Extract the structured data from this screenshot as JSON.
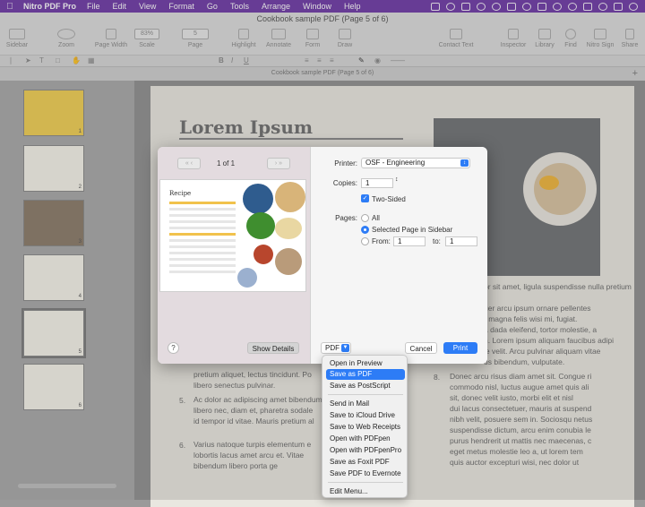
{
  "menubar": {
    "app": "Nitro PDF Pro",
    "items": [
      "File",
      "Edit",
      "View",
      "Format",
      "Go",
      "Tools",
      "Arrange",
      "Window",
      "Help"
    ],
    "clock_date": "",
    "bg_color": "#6e3aa6"
  },
  "toolbar": {
    "document_title": "Cookbook sample PDF (Page 5 of 6)",
    "items": [
      "Sidebar",
      "Zoom",
      "Page Width",
      "Scale",
      "Page",
      "Highlight",
      "Annotate",
      "Form",
      "Draw",
      "Contact Text",
      "Inspector",
      "Library",
      "Find",
      "Nitro Sign",
      "Share"
    ],
    "scale_value": "83%",
    "page_value": "5"
  },
  "tabbar": {
    "tab_title": "Cookbook sample PDF (Page 5 of 6)"
  },
  "sidebar": {
    "thumb_labels": [
      "1",
      "2",
      "3",
      "4",
      "5",
      "6"
    ]
  },
  "page": {
    "title": "Lorem Ipsum",
    "right_lines": [
      "or sit amet, ligula suspendisse nulla pretium",
      "uer arcu ipsum ornare pellentes",
      "r magna felis wisi mi, fugiat.",
      "a dada eleifend, tortor molestie, a",
      "n. Lorem ipsum aliquam faucibus adipi",
      "ie velit. Arcu pulvinar aliquam vitae",
      "us bibendum, vulputate."
    ],
    "left_items": [
      {
        "num": "",
        "lines": [
          "pretium aliquet, lectus tincidunt. Po",
          "libero senectus pulvinar."
        ]
      },
      {
        "num": "5.",
        "lines": [
          "Ac dolor ac adipiscing amet bibendum",
          "libero nec, diam et, pharetra sodale",
          "id tempor id vitae. Mauris pretium al"
        ]
      },
      {
        "num": "6.",
        "lines": [
          "Varius natoque turpis elementum e",
          "lobortis lacus amet arcu et. Vitae",
          "bibendum libero porta ge"
        ]
      }
    ],
    "right_items": [
      {
        "num": "8.",
        "lines": [
          "Donec arcu risus diam amet sit. Congue ri",
          "commodo nisl, luctus augue amet quis ali",
          "sit, donec velit iusto, morbi elit et nisl",
          "dui lacus consectetuer, mauris at suspend",
          "nibh velit, posuere sem in. Sociosqu netus",
          "suspendisse dictum, arcu enim conubia le",
          "purus hendrerit ut mattis nec maecenas, c",
          "eget metus molestie leo a, ut lorem tem",
          "quis auctor excepturi wisi, nec dolor ut"
        ]
      }
    ]
  },
  "dialog": {
    "pager": "1 of 1",
    "preview_title": "Recipe",
    "show_details": "Show Details",
    "help": "?",
    "printer_label": "Printer:",
    "printer_value": "OSF - Engineering",
    "copies_label": "Copies:",
    "copies_value": "1",
    "two_sided": "Two-Sided",
    "pages_label": "Pages:",
    "pages_all": "All",
    "pages_selected": "Selected Page in Sidebar",
    "pages_from": "From:",
    "pages_from_value": "1",
    "pages_to": "to:",
    "pages_to_value": "1",
    "pdf_label": "PDF",
    "cancel": "Cancel",
    "print": "Print"
  },
  "pdf_menu": {
    "items": [
      "Open in Preview",
      "Save as PDF",
      "Save as PostScript",
      "Send in Mail",
      "Save to iCloud Drive",
      "Save to Web Receipts",
      "Open with PDFpen",
      "Open with PDFpenPro",
      "Save as Foxit PDF",
      "Save PDF to Evernote",
      "Edit Menu..."
    ],
    "selected": "Save as PDF"
  }
}
